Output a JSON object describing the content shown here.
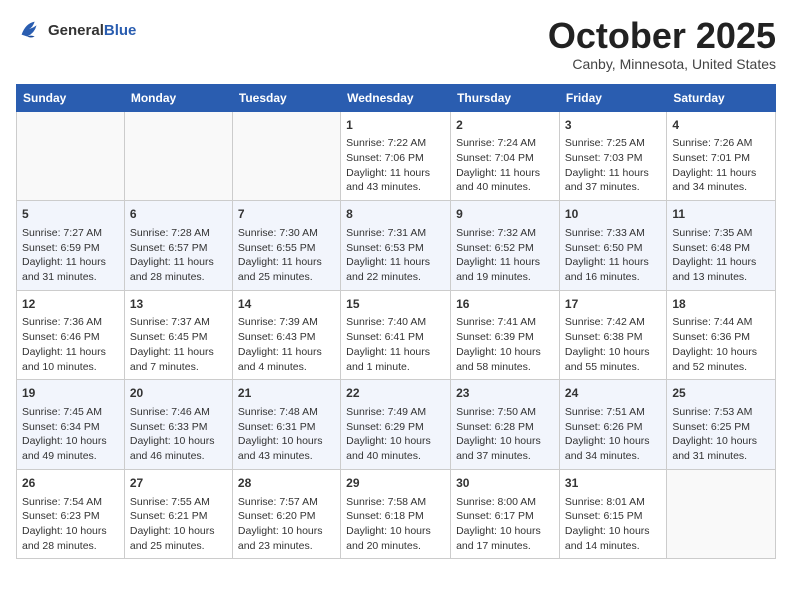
{
  "header": {
    "logo": {
      "general": "General",
      "blue": "Blue"
    },
    "title": "October 2025",
    "location": "Canby, Minnesota, United States"
  },
  "calendar": {
    "days_of_week": [
      "Sunday",
      "Monday",
      "Tuesday",
      "Wednesday",
      "Thursday",
      "Friday",
      "Saturday"
    ],
    "weeks": [
      [
        {
          "day": "",
          "content": ""
        },
        {
          "day": "",
          "content": ""
        },
        {
          "day": "",
          "content": ""
        },
        {
          "day": "1",
          "content": "Sunrise: 7:22 AM\nSunset: 7:06 PM\nDaylight: 11 hours\nand 43 minutes."
        },
        {
          "day": "2",
          "content": "Sunrise: 7:24 AM\nSunset: 7:04 PM\nDaylight: 11 hours\nand 40 minutes."
        },
        {
          "day": "3",
          "content": "Sunrise: 7:25 AM\nSunset: 7:03 PM\nDaylight: 11 hours\nand 37 minutes."
        },
        {
          "day": "4",
          "content": "Sunrise: 7:26 AM\nSunset: 7:01 PM\nDaylight: 11 hours\nand 34 minutes."
        }
      ],
      [
        {
          "day": "5",
          "content": "Sunrise: 7:27 AM\nSunset: 6:59 PM\nDaylight: 11 hours\nand 31 minutes."
        },
        {
          "day": "6",
          "content": "Sunrise: 7:28 AM\nSunset: 6:57 PM\nDaylight: 11 hours\nand 28 minutes."
        },
        {
          "day": "7",
          "content": "Sunrise: 7:30 AM\nSunset: 6:55 PM\nDaylight: 11 hours\nand 25 minutes."
        },
        {
          "day": "8",
          "content": "Sunrise: 7:31 AM\nSunset: 6:53 PM\nDaylight: 11 hours\nand 22 minutes."
        },
        {
          "day": "9",
          "content": "Sunrise: 7:32 AM\nSunset: 6:52 PM\nDaylight: 11 hours\nand 19 minutes."
        },
        {
          "day": "10",
          "content": "Sunrise: 7:33 AM\nSunset: 6:50 PM\nDaylight: 11 hours\nand 16 minutes."
        },
        {
          "day": "11",
          "content": "Sunrise: 7:35 AM\nSunset: 6:48 PM\nDaylight: 11 hours\nand 13 minutes."
        }
      ],
      [
        {
          "day": "12",
          "content": "Sunrise: 7:36 AM\nSunset: 6:46 PM\nDaylight: 11 hours\nand 10 minutes."
        },
        {
          "day": "13",
          "content": "Sunrise: 7:37 AM\nSunset: 6:45 PM\nDaylight: 11 hours\nand 7 minutes."
        },
        {
          "day": "14",
          "content": "Sunrise: 7:39 AM\nSunset: 6:43 PM\nDaylight: 11 hours\nand 4 minutes."
        },
        {
          "day": "15",
          "content": "Sunrise: 7:40 AM\nSunset: 6:41 PM\nDaylight: 11 hours\nand 1 minute."
        },
        {
          "day": "16",
          "content": "Sunrise: 7:41 AM\nSunset: 6:39 PM\nDaylight: 10 hours\nand 58 minutes."
        },
        {
          "day": "17",
          "content": "Sunrise: 7:42 AM\nSunset: 6:38 PM\nDaylight: 10 hours\nand 55 minutes."
        },
        {
          "day": "18",
          "content": "Sunrise: 7:44 AM\nSunset: 6:36 PM\nDaylight: 10 hours\nand 52 minutes."
        }
      ],
      [
        {
          "day": "19",
          "content": "Sunrise: 7:45 AM\nSunset: 6:34 PM\nDaylight: 10 hours\nand 49 minutes."
        },
        {
          "day": "20",
          "content": "Sunrise: 7:46 AM\nSunset: 6:33 PM\nDaylight: 10 hours\nand 46 minutes."
        },
        {
          "day": "21",
          "content": "Sunrise: 7:48 AM\nSunset: 6:31 PM\nDaylight: 10 hours\nand 43 minutes."
        },
        {
          "day": "22",
          "content": "Sunrise: 7:49 AM\nSunset: 6:29 PM\nDaylight: 10 hours\nand 40 minutes."
        },
        {
          "day": "23",
          "content": "Sunrise: 7:50 AM\nSunset: 6:28 PM\nDaylight: 10 hours\nand 37 minutes."
        },
        {
          "day": "24",
          "content": "Sunrise: 7:51 AM\nSunset: 6:26 PM\nDaylight: 10 hours\nand 34 minutes."
        },
        {
          "day": "25",
          "content": "Sunrise: 7:53 AM\nSunset: 6:25 PM\nDaylight: 10 hours\nand 31 minutes."
        }
      ],
      [
        {
          "day": "26",
          "content": "Sunrise: 7:54 AM\nSunset: 6:23 PM\nDaylight: 10 hours\nand 28 minutes."
        },
        {
          "day": "27",
          "content": "Sunrise: 7:55 AM\nSunset: 6:21 PM\nDaylight: 10 hours\nand 25 minutes."
        },
        {
          "day": "28",
          "content": "Sunrise: 7:57 AM\nSunset: 6:20 PM\nDaylight: 10 hours\nand 23 minutes."
        },
        {
          "day": "29",
          "content": "Sunrise: 7:58 AM\nSunset: 6:18 PM\nDaylight: 10 hours\nand 20 minutes."
        },
        {
          "day": "30",
          "content": "Sunrise: 8:00 AM\nSunset: 6:17 PM\nDaylight: 10 hours\nand 17 minutes."
        },
        {
          "day": "31",
          "content": "Sunrise: 8:01 AM\nSunset: 6:15 PM\nDaylight: 10 hours\nand 14 minutes."
        },
        {
          "day": "",
          "content": ""
        }
      ]
    ]
  }
}
